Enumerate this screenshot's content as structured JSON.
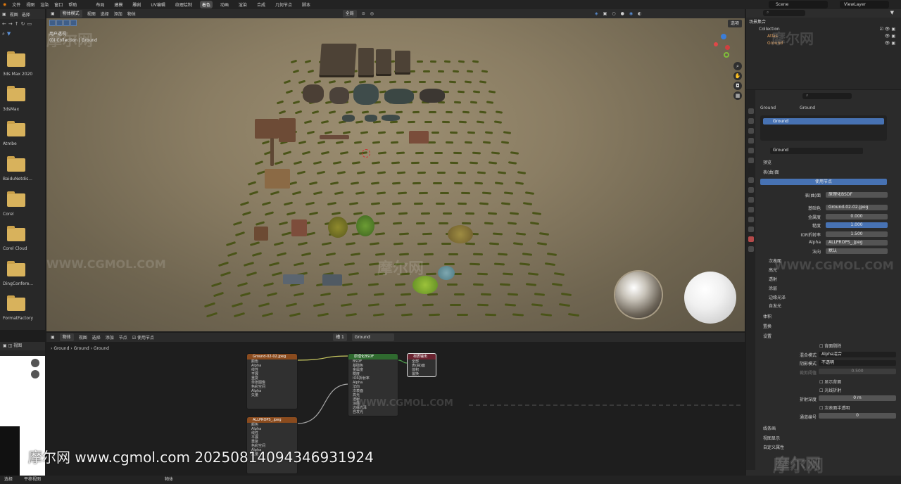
{
  "topbar": {
    "menus": [
      "文件",
      "视图",
      "渲染",
      "窗口",
      "帮助"
    ],
    "workspaces": [
      "布局",
      "建模",
      "雕刻",
      "UV编辑",
      "纹理绘制",
      "着色",
      "动画",
      "渲染",
      "合成",
      "几何节点",
      "脚本"
    ],
    "active_workspace": "着色",
    "scene": "Scene",
    "view_layer": "ViewLayer"
  },
  "filebrowser": {
    "header": [
      "视图",
      "选择"
    ],
    "folders": [
      "3ds Max 2020",
      "3dsMax",
      "Atmbe",
      "BaiduNetdis...",
      "Corel",
      "Corel Cloud",
      "DingConfere...",
      "FormatFactory"
    ]
  },
  "viewport": {
    "mode": "物体模式",
    "menus": [
      "视图",
      "选择",
      "添加",
      "物体"
    ],
    "shading": "全局",
    "info_line1": "用户透视",
    "info_line2": "(0) Collection | Ground",
    "options": "选项"
  },
  "outliner": {
    "title": "场景集合",
    "rows": [
      "Collection",
      "Atlas",
      "Ground"
    ]
  },
  "properties": {
    "breadcrumb_obj": "Ground",
    "breadcrumb_mat": "Ground",
    "slot": "Ground",
    "material_name": "Ground",
    "sections": {
      "preview": "预览",
      "surface": "表(曲)面",
      "use_nodes": "使用节点",
      "volume": "体积",
      "displacement": "置换",
      "settings": "设置",
      "line_art": "线条画",
      "viewport_display": "视图显示",
      "custom_props": "自定义属性"
    },
    "surface_rows": [
      {
        "label": "表(曲)面",
        "value": "原理化BSDF"
      },
      {
        "label": "基础色",
        "value": "Ground-02-02.jpeg"
      },
      {
        "label": "金属度",
        "value": "0.000"
      },
      {
        "label": "糙度",
        "value": "1.000"
      },
      {
        "label": "IOR折射率",
        "value": "1.500"
      },
      {
        "label": "Alpha",
        "value": "ALLPROPS_.jpeg"
      },
      {
        "label": "法向",
        "value": "默认"
      }
    ],
    "sub_sections": [
      "次表面",
      "高光",
      "透射",
      "涂层",
      "边缘光泽",
      "自发光"
    ],
    "settings_rows": [
      {
        "label": "背面剔除",
        "value": ""
      },
      {
        "label": "混合模式",
        "value": "Alpha混合"
      },
      {
        "label": "阴影模式",
        "value": "不透明"
      },
      {
        "label": "裁剪阈值",
        "value": "0.500"
      },
      {
        "label": "显示背面",
        "value": ""
      },
      {
        "label": "光线折射",
        "value": ""
      },
      {
        "label": "折射深度",
        "value": "0 m"
      },
      {
        "label": "次表面半透明",
        "value": ""
      },
      {
        "label": "通道编号",
        "value": "0"
      }
    ]
  },
  "node_editor": {
    "mode": "物体",
    "menus": [
      "视图",
      "选择",
      "添加",
      "节点"
    ],
    "use_nodes": "使用节点",
    "slot": "槽 1",
    "material": "Ground",
    "breadcrumb": [
      "Ground",
      "Ground",
      "Ground"
    ],
    "nodes": {
      "tex1": {
        "title": "Ground-02-02.jpeg",
        "rows": [
          "颜色",
          "Alpha",
          "线性",
          "平展",
          "重复",
          "单张图像",
          "色彩空间",
          "Alpha",
          "矢量"
        ]
      },
      "tex2": {
        "title": "ALLPROPS_.jpeg",
        "rows": [
          "颜色",
          "Alpha",
          "线性",
          "平展",
          "重复",
          "色彩空间",
          "Alpha",
          "矢量"
        ]
      },
      "bsdf": {
        "title": "原理化BSDF",
        "rows": [
          "BSDF",
          "基础色",
          "金属度",
          "糙度",
          "IOR折射率",
          "Alpha",
          "法向",
          "次表面",
          "高光",
          "透射",
          "涂层",
          "边缘光泽",
          "自发光"
        ]
      },
      "out": {
        "title": "材质输出",
        "rows": [
          "全部",
          "表(曲)面",
          "体积",
          "置换"
        ]
      }
    }
  },
  "status": {
    "left": "选择",
    "mid": "平移视图",
    "right": "物体"
  },
  "watermark": {
    "text": "摩尔网 www.cgmol.com 20250814094346931924",
    "brand": "摩尔网",
    "url": "WWW.CGMOL.COM"
  }
}
